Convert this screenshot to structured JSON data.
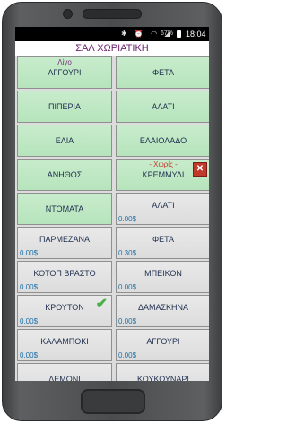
{
  "status_bar": {
    "icons": [
      "bluetooth-icon",
      "alarm-icon",
      "wifi-icon",
      "signal-icon"
    ],
    "battery": "67%",
    "time": "18:04"
  },
  "header": {
    "title": "ΣΑΛ ΧΩΡΙΑΤΙΚΗ"
  },
  "tiles": [
    {
      "name": "ΑΓΓΟΥΡΙ",
      "modifier": "Λίγο",
      "price": "",
      "style": "green"
    },
    {
      "name": "ΦΕΤΑ",
      "modifier": "",
      "price": "",
      "style": "green"
    },
    {
      "name": "ΠΙΠΕΡΙΑ",
      "modifier": "",
      "price": "",
      "style": "green"
    },
    {
      "name": "ΑΛΑΤΙ",
      "modifier": "",
      "price": "",
      "style": "green"
    },
    {
      "name": "ΕΛΙΑ",
      "modifier": "",
      "price": "",
      "style": "green"
    },
    {
      "name": "ΕΛΑΙΟΛΑΔΟ",
      "modifier": "",
      "price": "",
      "style": "green"
    },
    {
      "name": "ΑΝΗΘΟΣ",
      "modifier": "",
      "price": "",
      "style": "green"
    },
    {
      "name": "ΚΡΕΜΜΥΔΙ",
      "modifier": "- Χωρίς -",
      "price": "",
      "style": "green",
      "delete": true
    },
    {
      "name": "ΝΤΟΜΑΤΑ",
      "modifier": "",
      "price": "",
      "style": "green"
    },
    {
      "name": "ΑΛΑΤΙ",
      "modifier": "",
      "price": "0.00$",
      "style": "gray"
    },
    {
      "name": "ΠΑΡΜΕΖΑΝΑ",
      "modifier": "",
      "price": "0.00$",
      "style": "gray"
    },
    {
      "name": "ΦΕΤΑ",
      "modifier": "",
      "price": "0.30$",
      "style": "gray"
    },
    {
      "name": "ΚΟΤΟΠ ΒΡΑΣΤΟ",
      "modifier": "",
      "price": "0.00$",
      "style": "gray"
    },
    {
      "name": "ΜΠΕΙΚΟΝ",
      "modifier": "",
      "price": "0.00$",
      "style": "gray"
    },
    {
      "name": "ΚΡΟΥΤΟΝ",
      "modifier": "",
      "price": "0.00$",
      "style": "gray",
      "checked": true
    },
    {
      "name": "ΔΑΜΑΣΚΗΝΑ",
      "modifier": "",
      "price": "0.00$",
      "style": "gray"
    },
    {
      "name": "ΚΑΛΑΜΠΟΚΙ",
      "modifier": "",
      "price": "0.00$",
      "style": "gray"
    },
    {
      "name": "ΑΓΓΟΥΡΙ",
      "modifier": "",
      "price": "0.00$",
      "style": "gray"
    },
    {
      "name": "ΛΕΜΟΝΙ",
      "modifier": "",
      "price": "",
      "style": "gray"
    },
    {
      "name": "ΚΟΥΚΟΥΝΑΡΙ",
      "modifier": "",
      "price": "",
      "style": "gray"
    }
  ]
}
